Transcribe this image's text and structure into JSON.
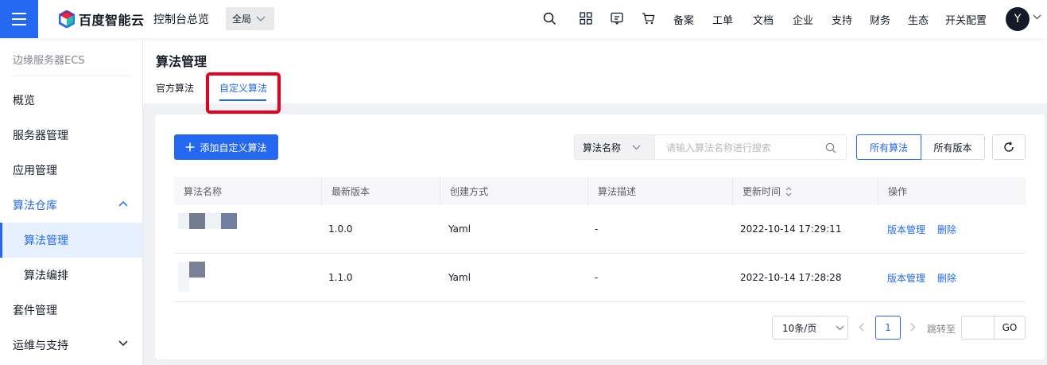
{
  "topbar": {
    "brand": "百度智能云",
    "console_title": "控制台总览",
    "region": "全局",
    "nav": [
      "备案",
      "工单",
      "文档",
      "企业",
      "支持",
      "财务",
      "生态",
      "开关配置"
    ],
    "icons": [
      "search-icon",
      "apps-icon",
      "message-icon",
      "cart-icon"
    ],
    "avatar": "Y"
  },
  "sidebar": {
    "title": "边缘服务器ECS",
    "items": [
      {
        "label": "概览"
      },
      {
        "label": "服务器管理"
      },
      {
        "label": "应用管理"
      },
      {
        "label": "算法仓库",
        "expanded": true
      },
      {
        "label": "算法管理",
        "active": true
      },
      {
        "label": "算法编排"
      },
      {
        "label": "套件管理"
      },
      {
        "label": "运维与支持"
      }
    ]
  },
  "page": {
    "title": "算法管理",
    "tabs": [
      {
        "label": "官方算法"
      },
      {
        "label": "自定义算法",
        "active": true
      }
    ]
  },
  "toolbar": {
    "add_label": "添加自定义算法",
    "search_field": "算法名称",
    "search_placeholder": "请输入算法名称进行搜索",
    "filter_all_algorithms": "所有算法",
    "filter_all_versions": "所有版本"
  },
  "table": {
    "columns": [
      "算法名称",
      "最新版本",
      "创建方式",
      "算法描述",
      "更新时间",
      "操作"
    ],
    "rows": [
      {
        "version": "1.0.0",
        "method": "Yaml",
        "desc": "-",
        "updated": "2022-10-14 17:29:11",
        "op_manage": "版本管理",
        "op_delete": "删除"
      },
      {
        "version": "1.1.0",
        "method": "Yaml",
        "desc": "-",
        "updated": "2022-10-14 17:28:28",
        "op_manage": "版本管理",
        "op_delete": "删除"
      }
    ]
  },
  "pagination": {
    "page_size": "10条/页",
    "current_page": "1",
    "jump_label": "跳转至",
    "go_label": "GO"
  },
  "colors": {
    "accent": "#2468f2",
    "highlight": "#e8001c"
  }
}
